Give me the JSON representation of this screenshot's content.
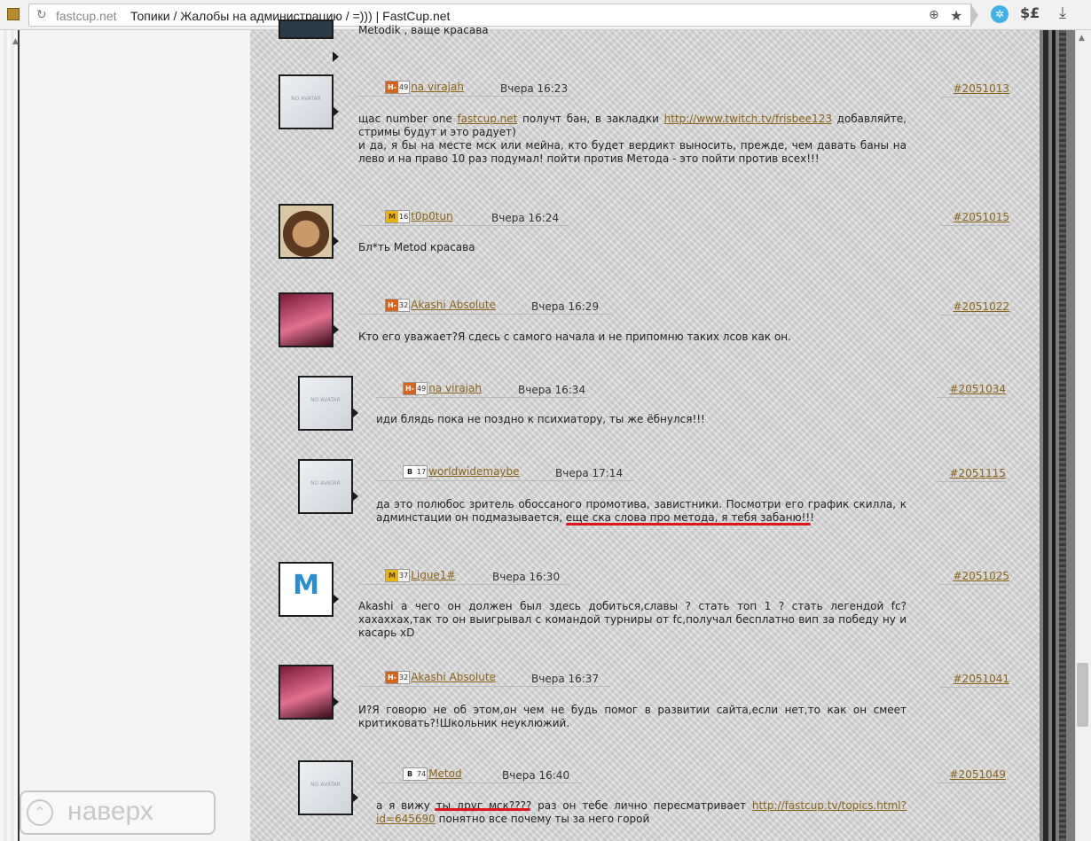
{
  "browser": {
    "host": "fastcup.net",
    "title": "Топики / Жалобы на администрацию / =))) | FastCup.net",
    "ext_label": "$£"
  },
  "top_snippet": "Metodik , ваще красава",
  "comments": [
    {
      "badge_letter": "Н-",
      "level": "49",
      "user": "na virajah",
      "time": "Вчера 16:23",
      "anchor": "#2051013",
      "t1": "щас number one ",
      "l1": "fastcup.net",
      "t2": " получт бан, в закладки ",
      "l2": "http://www.twitch.tv/frisbee123",
      "t3": " добавляйте, стримы будут и это радует)",
      "t4": "и да, я бы на месте мск или мейна, кто будет вердикт выносить, прежде, чем давать баны на лево и на право 10 раз подумал! пойти против Метода - это пойти против всех!!!"
    },
    {
      "badge_letter": "М",
      "level": "16",
      "user": "t0p0tun",
      "time": "Вчера 16:24",
      "anchor": "#2051015",
      "text": "Бл*ть Metod красава"
    },
    {
      "badge_letter": "Н-",
      "level": "32",
      "user": "Akashi Absolute",
      "time": "Вчера 16:29",
      "anchor": "#2051022",
      "text": "Кто его уважает?Я сдесь с самого начала и не припомню таких лсов как он."
    },
    {
      "badge_letter": "Н-",
      "level": "49",
      "user": "na virajah",
      "time": "Вчера 16:34",
      "anchor": "#2051034",
      "text": "иди блядь пока не поздно к психиатору, ты же ёбнулся!!!"
    },
    {
      "badge_letter": "В",
      "level": "17",
      "user": "worldwidemaybe",
      "time": "Вчера 17:14",
      "anchor": "#2051115",
      "t1": "да это полюбос зритель обоссаного промотива, завистники. Посмотри его график скилла, к админстации он подмазывается, ",
      "t2": "еще ска слова про метода, я тебя забаню!!!"
    },
    {
      "badge_letter": "М",
      "level": "37",
      "user": "Ligue1#",
      "time": "Вчера 16:30",
      "anchor": "#2051025",
      "text": "Akashi а чего он должен был здесь добиться,славы ? стать топ 1 ? стать легендой fc?хахаххах,так то он выигрывал с командой турниры от fc,получал бесплатно вип за победу ну и касарь xD"
    },
    {
      "badge_letter": "Н-",
      "level": "32",
      "user": "Akashi Absolute",
      "time": "Вчера 16:37",
      "anchor": "#2051041",
      "text": "И?Я говорю не об этом,он чем не будь помог в развитии сайта,если нет,то как он смеет критиковать?!Школьник неуклюжий."
    },
    {
      "badge_letter": "В",
      "level": "74",
      "user": "Metod",
      "time": "Вчера 16:40",
      "anchor": "#2051049",
      "t1": "а я вижу ",
      "t2": "ты друг мск????",
      "t3": " раз он тебе лично пересматривает ",
      "l1": "http://fastcup.tv/topics.html?id=645690",
      "t4": " понятно все почему ты за него горой"
    }
  ],
  "no_avatar": "NO AVATAR",
  "avatar_om_glyph": "M",
  "scroll_top": {
    "icon": "⌃",
    "label": "наверх"
  },
  "colors": {
    "link": "#8a6418",
    "underline": "#e0141e",
    "badge_h": "#d8621a",
    "badge_m": "#e7b40f"
  }
}
